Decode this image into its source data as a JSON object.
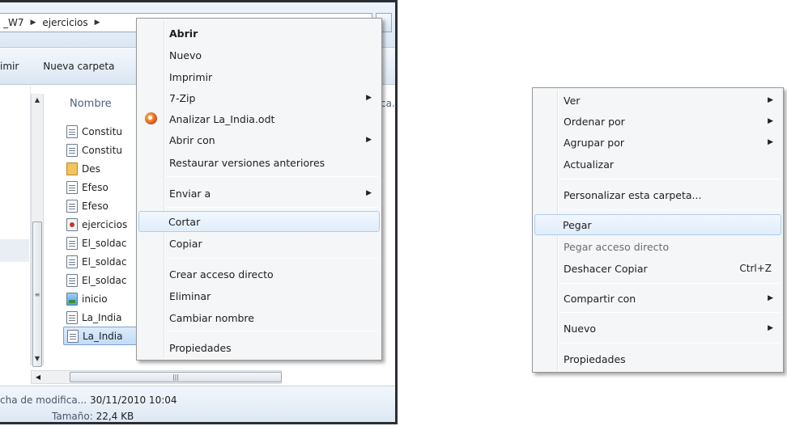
{
  "explorer": {
    "breadcrumb": [
      "_W7",
      "ejercicios"
    ],
    "toolbar": {
      "print_partial": "imir",
      "new_folder": "Nueva carpeta"
    },
    "column_name": "Nombre",
    "column_fragment": "ca.",
    "files": [
      {
        "name": "Constitu",
        "icon": "document-icon"
      },
      {
        "name": "Constitu",
        "icon": "document-icon"
      },
      {
        "name": "Des",
        "icon": "folder-icon"
      },
      {
        "name": "Efeso",
        "icon": "document-icon"
      },
      {
        "name": "Efeso",
        "icon": "document-icon"
      },
      {
        "name": "ejercicios",
        "icon": "html-icon"
      },
      {
        "name": "El_soldac",
        "icon": "document-icon"
      },
      {
        "name": "El_soldac",
        "icon": "document-icon"
      },
      {
        "name": "El_soldac",
        "icon": "document-icon"
      },
      {
        "name": "inicio",
        "icon": "image-icon"
      },
      {
        "name": "La_India",
        "icon": "document-icon"
      },
      {
        "name": "La_India",
        "icon": "document-icon",
        "selected": true
      }
    ],
    "details": {
      "modified_label": "cha de modifica...",
      "modified_value": "30/11/2010 10:04",
      "size_label": "Tamaño:",
      "size_value": "22,4 KB"
    }
  },
  "file_menu": {
    "items": [
      {
        "label": "Abrir",
        "bold": true
      },
      {
        "label": "Nuevo"
      },
      {
        "label": "Imprimir"
      },
      {
        "label": "7-Zip",
        "submenu": true
      },
      {
        "label": "Analizar La_India.odt",
        "icon": "antivirus-icon"
      },
      {
        "label": "Abrir con",
        "submenu": true
      },
      {
        "label": "Restaurar versiones anteriores"
      },
      {
        "label": "Enviar a",
        "submenu": true
      },
      {
        "label": "Cortar",
        "hover": true
      },
      {
        "label": "Copiar"
      },
      {
        "label": "Crear acceso directo"
      },
      {
        "label": "Eliminar"
      },
      {
        "label": "Cambiar nombre"
      },
      {
        "label": "Propiedades"
      }
    ]
  },
  "background_menu": {
    "items": [
      {
        "label": "Ver",
        "submenu": true
      },
      {
        "label": "Ordenar por",
        "submenu": true
      },
      {
        "label": "Agrupar por",
        "submenu": true
      },
      {
        "label": "Actualizar"
      },
      {
        "label": "Personalizar esta carpeta..."
      },
      {
        "label": "Pegar",
        "hover": true
      },
      {
        "label": "Pegar acceso directo",
        "disabled": true
      },
      {
        "label": "Deshacer Copiar",
        "shortcut": "Ctrl+Z"
      },
      {
        "label": "Compartir con",
        "submenu": true
      },
      {
        "label": "Nuevo",
        "submenu": true
      },
      {
        "label": "Propiedades"
      }
    ]
  }
}
